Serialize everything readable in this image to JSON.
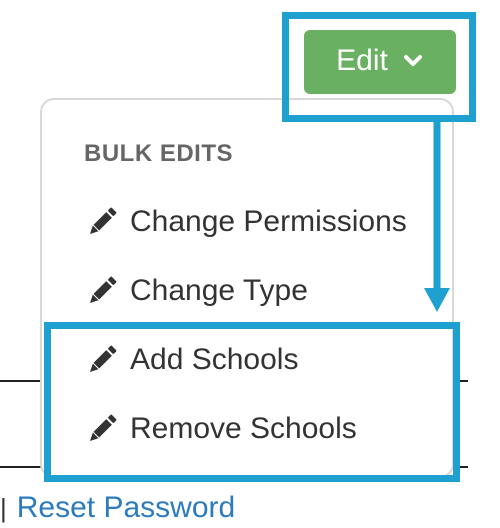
{
  "edit_button": {
    "label": "Edit",
    "icon": "chevron-down-icon"
  },
  "dropdown": {
    "header": "BULK EDITS",
    "items": [
      {
        "label": "Change Permissions",
        "icon": "pencil-icon"
      },
      {
        "label": "Change Type",
        "icon": "pencil-icon"
      },
      {
        "label": "Add Schools",
        "icon": "pencil-icon"
      },
      {
        "label": "Remove Schools",
        "icon": "pencil-icon"
      }
    ]
  },
  "background": {
    "separator": "|",
    "link_text": "Reset Password"
  },
  "colors": {
    "button_green": "#6ab063",
    "highlight_blue": "#1ea1d1",
    "link_blue": "#2b7bbd",
    "menu_text": "#333333",
    "header_gray": "#666666"
  }
}
